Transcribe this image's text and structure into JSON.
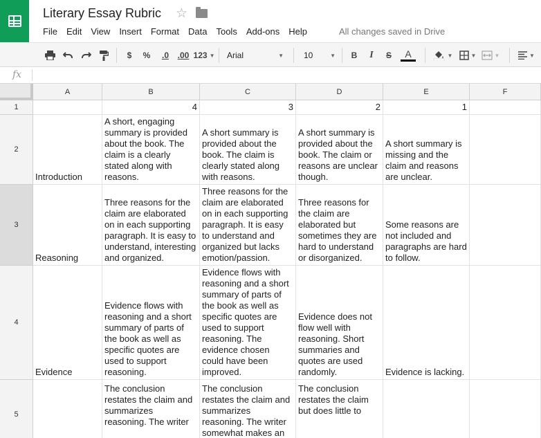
{
  "app": {
    "title": "Literary Essay Rubric",
    "save_status": "All changes saved in Drive",
    "menu": [
      "File",
      "Edit",
      "View",
      "Insert",
      "Format",
      "Data",
      "Tools",
      "Add-ons",
      "Help"
    ]
  },
  "toolbar": {
    "currency": "$",
    "percent": "%",
    "decrease_decimals": ".0",
    "increase_decimals": ".00",
    "more_formats": "123",
    "font": "Arial",
    "font_size": "10",
    "bold": "B",
    "italic": "I",
    "strikethrough": "S",
    "text_color": "A",
    "accent_color": "#0f9d58"
  },
  "formula_bar": {
    "fx": "fx",
    "value": ""
  },
  "grid": {
    "columns": [
      "A",
      "B",
      "C",
      "D",
      "E",
      "F"
    ],
    "rows": [
      {
        "num": "1",
        "cells": [
          "",
          "4",
          "3",
          "2",
          "1",
          ""
        ]
      },
      {
        "num": "2",
        "cells": [
          "Introduction",
          "A short, engaging summary is provided about the book. The claim is a clearly stated along with reasons.",
          "A short summary is provided about the book. The claim is clearly stated along with reasons.",
          "A short summary is provided about the book. The claim or reasons are unclear though.",
          "A short summary is missing and the claim and reasons are unclear.",
          ""
        ]
      },
      {
        "num": "3",
        "cells": [
          "Reasoning",
          "Three reasons for the claim are elaborated on in each supporting paragraph. It is easy to understand, interesting and organized.",
          "Three reasons for the claim are elaborated on in each supporting paragraph. It is easy to understand and organized but lacks emotion/passion.",
          "Three reasons for the claim are elaborated but sometimes they are hard to understand or disorganized.",
          "Some reasons are not included and paragraphs are hard to follow.",
          ""
        ]
      },
      {
        "num": "4",
        "cells": [
          "Evidence",
          "Evidence flows with reasoning and a short summary of parts of the book as well as specific quotes are used to support reasoning.",
          "Evidence flows with reasoning and a short summary of parts of the book as well as specific quotes are used to support reasoning. The evidence chosen could have been improved.",
          "Evidence does not flow well with reasoning. Short summaries and quotes are used randomly.",
          "Evidence is lacking.",
          ""
        ]
      },
      {
        "num": "5",
        "cells": [
          "",
          "The conclusion restates the claim and summarizes reasoning. The writer",
          "The conclusion restates the claim and summarizes reasoning. The writer somewhat makes an",
          "The conclusion restates the claim but does little to",
          "",
          ""
        ]
      }
    ]
  }
}
